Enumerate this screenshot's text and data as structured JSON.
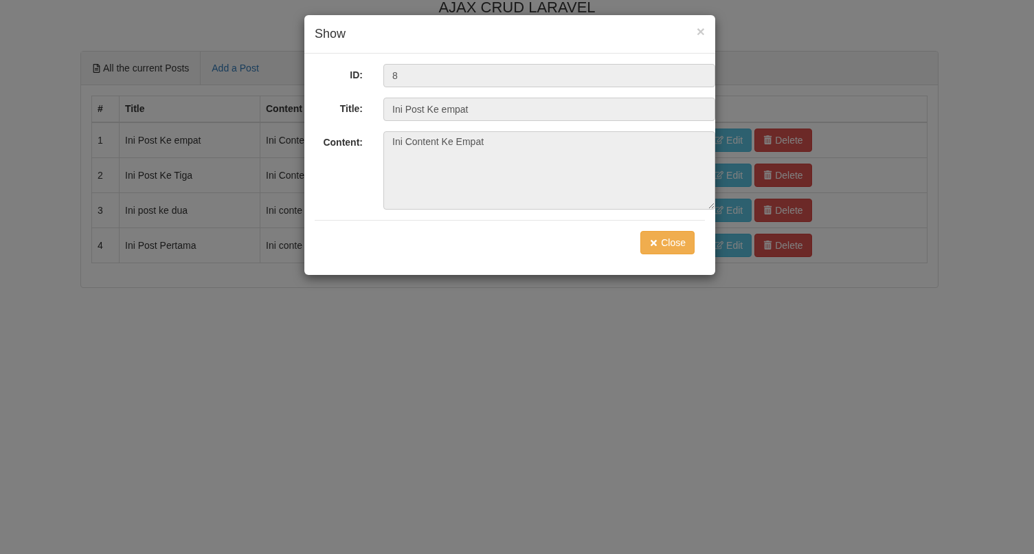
{
  "page_title": "AJAX CRUD LARAVEL",
  "tabs": [
    {
      "label": "All the current Posts",
      "selected": true
    },
    {
      "label": "Add a Post",
      "selected": false
    }
  ],
  "table": {
    "columns": [
      "#",
      "Title",
      "Content"
    ],
    "rows": [
      {
        "number": "1",
        "title": "Ini Post Ke empat",
        "content": "Ini Conte",
        "actions": [
          "Edit",
          "Delete"
        ]
      },
      {
        "number": "2",
        "title": "Ini Post Ke Tiga",
        "content": "Ini Conte",
        "actions": [
          "Edit",
          "Delete"
        ]
      },
      {
        "number": "3",
        "title": "Ini post ke dua",
        "content": "Ini conte",
        "actions": [
          "Edit",
          "Delete"
        ]
      },
      {
        "number": "4",
        "title": "Ini Post Pertama",
        "content": "Ini conte",
        "actions": [
          "Edit",
          "Delete"
        ]
      }
    ]
  },
  "modal": {
    "title": "Show",
    "close_symbol": "×",
    "fields": [
      {
        "label": "ID:",
        "value": "8",
        "kind": "input"
      },
      {
        "label": "Title:",
        "value": "Ini Post Ke empat",
        "kind": "input"
      },
      {
        "label": "Content:",
        "value": "Ini Content Ke Empat",
        "kind": "textarea"
      }
    ],
    "button": "Close"
  }
}
